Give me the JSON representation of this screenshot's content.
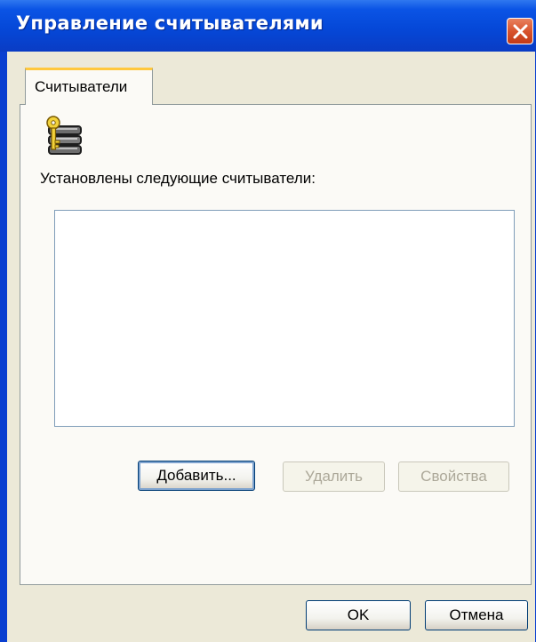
{
  "window": {
    "title": "Управление считывателями"
  },
  "tabs": [
    {
      "label": "Считыватели",
      "active": true
    }
  ],
  "readers_panel": {
    "icon": "card-reader-key-icon",
    "label": "Установлены следующие считыватели:",
    "readers": []
  },
  "buttons": {
    "add": "Добавить...",
    "remove": "Удалить",
    "properties": "Свойства",
    "ok": "OK",
    "cancel": "Отмена"
  },
  "colors": {
    "titlebar": "#0548d8",
    "dialog_bg": "#ece9d8",
    "tab_highlight": "#ffc83c",
    "close_button": "#d8532d"
  }
}
